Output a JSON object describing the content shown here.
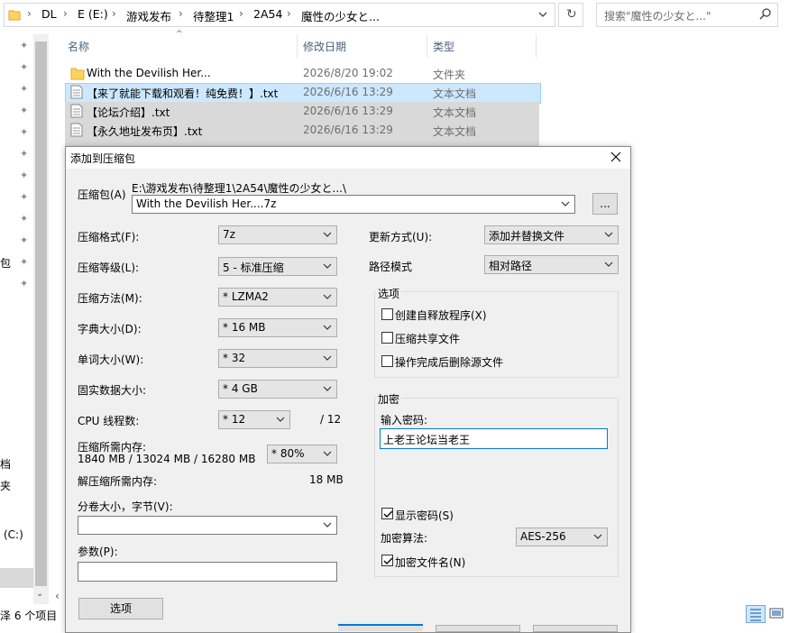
{
  "address": {
    "crumbs": [
      "DL",
      "E (E:)",
      "游戏发布",
      "待整理1",
      "2A54",
      "魔性の少女と..."
    ],
    "search_placeholder": "搜索\"魔性の少女と...\""
  },
  "columns": {
    "name": "名称",
    "date": "修改日期",
    "type": "类型"
  },
  "files": [
    {
      "name": "With the Devilish Her...",
      "date": "2026/8/20 19:02",
      "type": "文件夹",
      "icon": "folder-icon"
    },
    {
      "name": "【来了就能下载和观看！纯免费！】.txt",
      "date": "2026/6/16 13:29",
      "type": "文本文档",
      "icon": "text-file-icon"
    },
    {
      "name": "【论坛介绍】.txt",
      "date": "2026/6/16 13:29",
      "type": "文本文档",
      "icon": "text-file-icon"
    },
    {
      "name": "【永久地址发布页】.txt",
      "date": "2026/6/16 13:29",
      "type": "文本文档",
      "icon": "text-file-icon"
    }
  ],
  "nav_fragments": [
    "包",
    "档",
    "夹",
    "(C:)"
  ],
  "status": {
    "text": "泽 6 个项目"
  },
  "dialog": {
    "title": "添加到压缩包",
    "archive_label": "压缩包(A)",
    "archive_path": "E:\\游戏发布\\待整理1\\2A54\\魔性の少女と...\\",
    "archive_name": "With the Devilish Her....7z",
    "browse_label": "...",
    "left": {
      "format_label": "压缩格式(F):",
      "format_value": "7z",
      "level_label": "压缩等级(L):",
      "level_value": "5 - 标准压缩",
      "method_label": "压缩方法(M):",
      "method_value": "* LZMA2",
      "dict_label": "字典大小(D):",
      "dict_value": "* 16 MB",
      "word_label": "单词大小(W):",
      "word_value": "* 32",
      "solid_label": "固实数据大小:",
      "solid_value": "* 4 GB",
      "threads_label": "CPU 线程数:",
      "threads_value": "* 12",
      "threads_total": "/ 12",
      "mem_label": "压缩所需内存:",
      "mem_value": "1840 MB / 13024 MB / 16280 MB",
      "mem_percent": "* 80%",
      "decomp_label": "解压缩所需内存:",
      "decomp_value": "18 MB",
      "volume_label": "分卷大小，字节(V):",
      "params_label": "参数(P):",
      "options_button": "选项"
    },
    "right": {
      "update_label": "更新方式(U):",
      "update_value": "添加并替换文件",
      "path_label": "路径模式",
      "path_value": "相对路径",
      "options_group": "选项",
      "opt_sfx": "创建自释放程序(X)",
      "opt_sfx_checked": false,
      "opt_shared": "压缩共享文件",
      "opt_shared_checked": false,
      "opt_delete": "操作完成后删除源文件",
      "opt_delete_checked": false,
      "encrypt_group": "加密",
      "password_label": "输入密码:",
      "password_value": "上老王论坛当老王",
      "show_password": "显示密码(S)",
      "show_password_checked": true,
      "method_label": "加密算法:",
      "method_value": "AES-256",
      "encrypt_names": "加密文件名(N)",
      "encrypt_names_checked": true
    }
  },
  "colors": {
    "selected_row": "#cce8ff",
    "gray_row": "#d9d9d9",
    "accent": "#0078d7"
  }
}
